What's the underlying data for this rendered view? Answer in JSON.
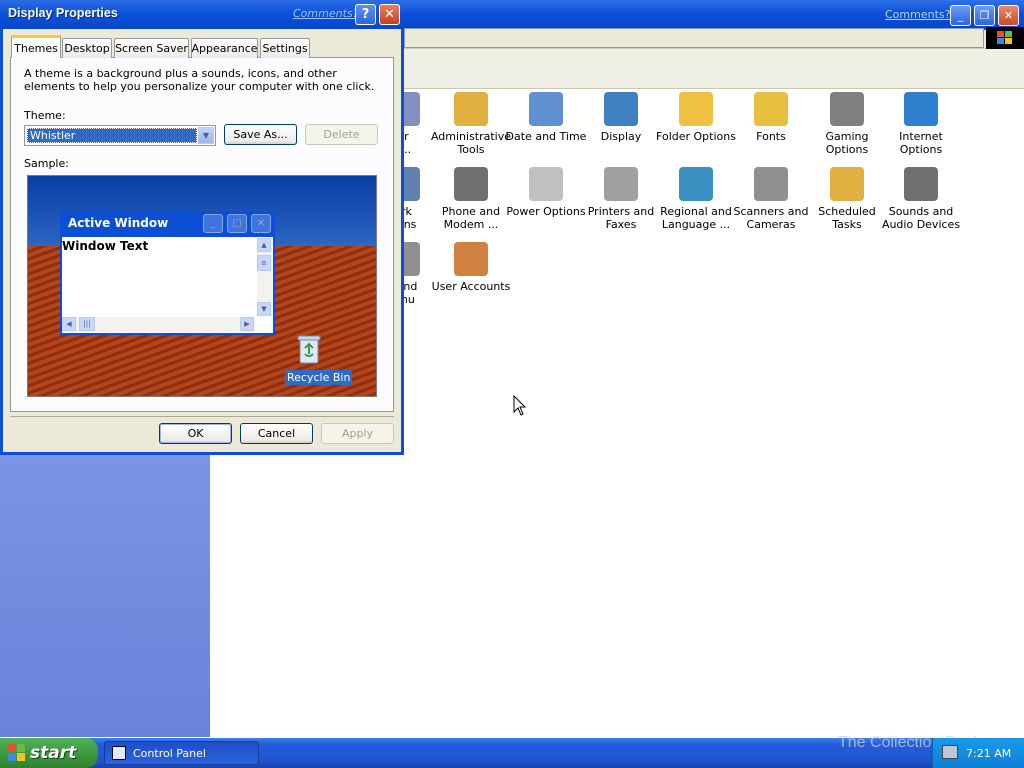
{
  "control_panel": {
    "comments_link": "Comments?",
    "items": [
      {
        "label": "or\nv...",
        "color": "#8090c0"
      },
      {
        "label": "Administrative Tools",
        "color": "#e0b040"
      },
      {
        "label": "Date and Time",
        "color": "#6090d0"
      },
      {
        "label": "Display",
        "color": "#4080c0"
      },
      {
        "label": "Folder Options",
        "color": "#f0c040"
      },
      {
        "label": "Fonts",
        "color": "#e8c040"
      },
      {
        "label": "Gaming Options",
        "color": "#808080"
      },
      {
        "label": "Internet Options",
        "color": "#3080d0"
      },
      {
        "label": "ork\ntions",
        "color": "#6080b0"
      },
      {
        "label": "Phone and Modem ...",
        "color": "#707070"
      },
      {
        "label": "Power Options",
        "color": "#c0c0c0"
      },
      {
        "label": "Printers and Faxes",
        "color": "#a0a0a0"
      },
      {
        "label": "Regional and Language ...",
        "color": "#3a90c0"
      },
      {
        "label": "Scanners and Cameras",
        "color": "#909090"
      },
      {
        "label": "Scheduled Tasks",
        "color": "#e0b040"
      },
      {
        "label": "Sounds and Audio Devices",
        "color": "#707070"
      },
      {
        "label": "r and\nlenu",
        "color": "#909090"
      },
      {
        "label": "User Accounts",
        "color": "#d08040"
      }
    ]
  },
  "dialog": {
    "title": "Display Properties",
    "comments_link": "Comments?",
    "help_label": "?",
    "close_label": "✕",
    "tabs": [
      "Themes",
      "Desktop",
      "Screen Saver",
      "Appearance",
      "Settings"
    ],
    "description": "A theme is a background plus a sounds, icons, and other elements to help you personalize your computer with one click.",
    "theme_label": "Theme:",
    "theme_value": "Whistler",
    "save_as_label": "Save As...",
    "delete_label": "Delete",
    "sample_label": "Sample:",
    "preview": {
      "window_title": "Active Window",
      "window_text": "Window Text",
      "recycle_label": "Recycle Bin"
    },
    "ok_label": "OK",
    "cancel_label": "Cancel",
    "apply_label": "Apply"
  },
  "taskbar": {
    "start_label": "start",
    "task_label": "Control Panel",
    "clock": "7:21 AM",
    "watermark": "The Collection Book"
  }
}
